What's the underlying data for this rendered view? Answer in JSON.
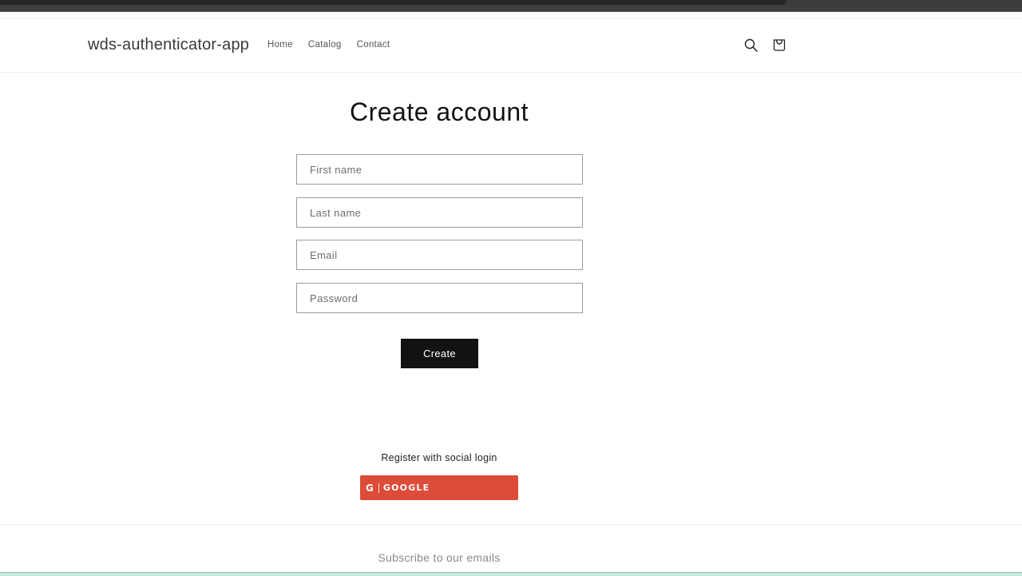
{
  "header": {
    "site_title": "wds-authenticator-app",
    "nav": [
      {
        "label": "Home"
      },
      {
        "label": "Catalog"
      },
      {
        "label": "Contact"
      }
    ],
    "icons": {
      "search": "search-icon",
      "cart": "cart-icon"
    }
  },
  "form": {
    "title": "Create account",
    "fields": {
      "first_name": {
        "placeholder": "First name",
        "value": ""
      },
      "last_name": {
        "placeholder": "Last name",
        "value": ""
      },
      "email": {
        "placeholder": "Email",
        "value": ""
      },
      "password": {
        "placeholder": "Password",
        "value": ""
      }
    },
    "submit_label": "Create"
  },
  "social": {
    "label": "Register with social login",
    "google": {
      "icon_letter": "G",
      "label": "GOOGLE",
      "color": "#dd4b39"
    }
  },
  "footer": {
    "subscribe_heading": "Subscribe to our emails"
  }
}
